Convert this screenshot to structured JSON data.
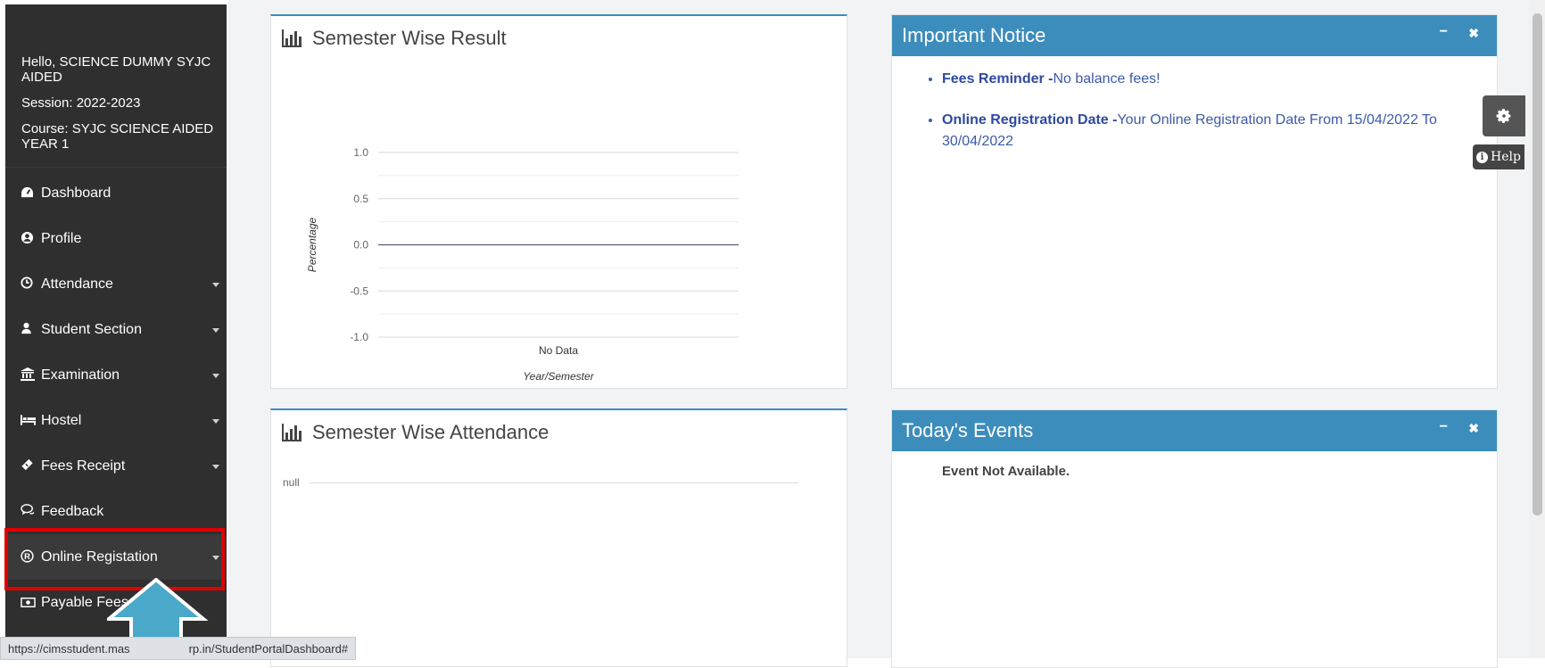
{
  "sidebar": {
    "greeting": "Hello, SCIENCE DUMMY SYJC AIDED",
    "session": "Session: 2022-2023",
    "course": "Course: SYJC SCIENCE AIDED YEAR 1",
    "items": [
      {
        "label": "Dashboard",
        "icon": "dashboard-icon",
        "has_caret": false
      },
      {
        "label": "Profile",
        "icon": "user-circle-icon",
        "has_caret": false
      },
      {
        "label": "Attendance",
        "icon": "clock-icon",
        "has_caret": true
      },
      {
        "label": "Student Section",
        "icon": "user-icon",
        "has_caret": true
      },
      {
        "label": "Examination",
        "icon": "institution-icon",
        "has_caret": true
      },
      {
        "label": "Hostel",
        "icon": "bed-icon",
        "has_caret": true
      },
      {
        "label": "Fees Receipt",
        "icon": "ticket-icon",
        "has_caret": true
      },
      {
        "label": "Feedback",
        "icon": "comments-icon",
        "has_caret": false
      },
      {
        "label": "Online Registation",
        "icon": "registered-icon",
        "has_caret": true
      },
      {
        "label": "Payable Fees",
        "icon": "money-icon",
        "has_caret": false
      }
    ]
  },
  "result_panel": {
    "title": "Semester Wise Result",
    "icon": "bar-chart-icon"
  },
  "attendance_panel": {
    "title": "Semester Wise Attendance",
    "icon": "bar-chart-icon",
    "null_label": "null"
  },
  "notice_panel": {
    "title": "Important Notice",
    "minimize_label": "−",
    "close_label": "✖",
    "notices": [
      {
        "heading": "Fees Reminder -",
        "text": "No balance fees!"
      },
      {
        "heading": "Online Registration Date -",
        "text": "Your Online Registration Date From 15/04/2022 To 30/04/2022"
      }
    ]
  },
  "events_panel": {
    "title": "Today's Events",
    "minimize_label": "−",
    "close_label": "✖",
    "message": "Event Not Available."
  },
  "help": {
    "label": "Help",
    "settings_icon": "gear-icon"
  },
  "status_bar": {
    "url": "https://cimsstudent.mas"
  },
  "status_bar_suffix": "rp.in/StudentPortalDashboard#",
  "colors": {
    "accent": "#3c8dbc",
    "sidebar": "#2f2f2f",
    "highlight": "#e00000",
    "arrow": "#4aa9c8"
  },
  "chart_data": {
    "type": "line",
    "categories": [
      "No Data"
    ],
    "series": [
      {
        "values": [
          0.0
        ]
      }
    ],
    "xlabel": "Year/Semester",
    "ylabel": "Percentage",
    "ylim": [
      -1.0,
      1.0
    ],
    "yticks": [
      1.0,
      0.5,
      0.0,
      -0.5,
      -1.0
    ],
    "grid": true
  }
}
